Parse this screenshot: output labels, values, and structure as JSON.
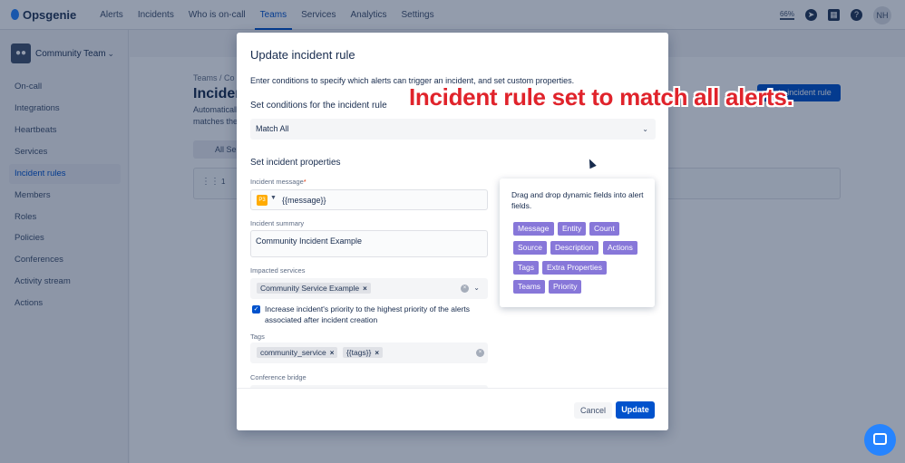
{
  "app": {
    "name": "Opsgenie",
    "nav": [
      "Alerts",
      "Incidents",
      "Who is on-call",
      "Teams",
      "Services",
      "Analytics",
      "Settings"
    ],
    "zoom": "66%",
    "user_initials": "NH"
  },
  "sidebar": {
    "team_name": "Community Team",
    "items": [
      "On-call",
      "Integrations",
      "Heartbeats",
      "Services",
      "Incident rules",
      "Members",
      "Roles",
      "Policies",
      "Conferences",
      "Activity stream",
      "Actions"
    ]
  },
  "page": {
    "breadcrumb": "Teams  / Co",
    "title": "Incident",
    "desc_line1": "Automaticall",
    "desc_line2": "matches the",
    "create_button": "reate incident rule",
    "filter_label": "All Se",
    "row_number": "1"
  },
  "modal": {
    "title": "Update incident rule",
    "intro": "Enter conditions to specify which alerts can trigger an incident, and set custom properties.",
    "conditions_heading": "Set conditions for the incident rule",
    "match_value": "Match All",
    "properties_heading": "Set incident properties",
    "message_label": "Incident message",
    "message_value": "{{message}}",
    "priority_badge": "P3",
    "summary_label": "Incident summary",
    "summary_value": "Community Incident Example",
    "services_label": "Impacted services",
    "service_chip": "Community Service Example",
    "increase_priority_text": "Increase incident's priority to the highest priority of the alerts associated after incident creation",
    "tags_label": "Tags",
    "tag_chips": [
      "community_service",
      "{{tags}}"
    ],
    "conference_label": "Conference bridge",
    "cancel_button": "Cancel",
    "update_button": "Update"
  },
  "dynamic_fields": {
    "instructions": "Drag and drop dynamic fields into alert fields.",
    "tags": [
      "Message",
      "Entity",
      "Count",
      "Source",
      "Description",
      "Actions",
      "Tags",
      "Extra Properties",
      "Teams",
      "Priority"
    ]
  },
  "annotation": "Incident rule set to match all alerts.",
  "colors": {
    "primary": "#0052cc",
    "dynamic_tag": "#8777d9",
    "annotation": "#e0232b",
    "priority_badge": "#ffab00"
  }
}
